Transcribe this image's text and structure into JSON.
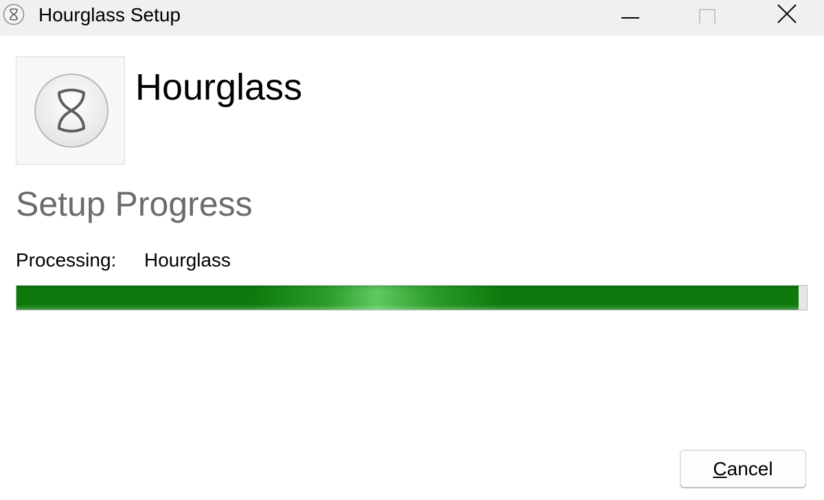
{
  "window": {
    "title": "Hourglass Setup",
    "controls": {
      "minimize_icon": "minimize-icon",
      "maximize_icon": "maximize-icon",
      "close_icon": "close-icon"
    }
  },
  "header": {
    "product_name": "Hourglass",
    "logo_icon": "hourglass-logo-icon"
  },
  "progress": {
    "section_title": "Setup Progress",
    "status_label": "Processing:",
    "status_value": "Hourglass",
    "fraction": 0.99,
    "color": "#0c7a0c"
  },
  "footer": {
    "cancel_mnemonic": "C",
    "cancel_rest": "ancel"
  }
}
